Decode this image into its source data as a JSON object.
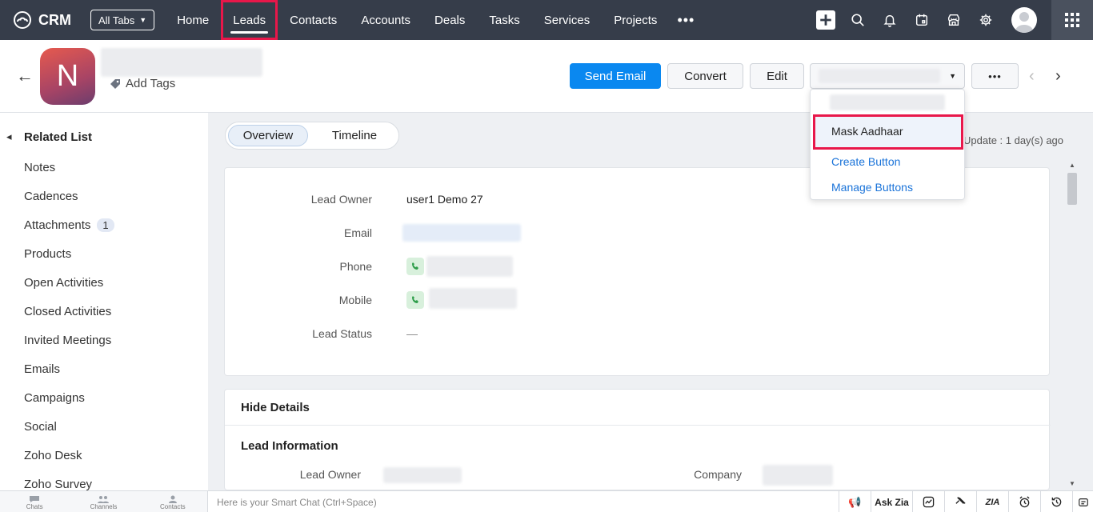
{
  "nav": {
    "brand": "CRM",
    "all_tabs": "All Tabs",
    "items": [
      "Home",
      "Leads",
      "Contacts",
      "Accounts",
      "Deals",
      "Tasks",
      "Services",
      "Projects"
    ],
    "active": "Leads",
    "more": "•••"
  },
  "record": {
    "avatar_letter": "N",
    "add_tags": "Add Tags",
    "buttons": {
      "send_email": "Send Email",
      "convert": "Convert",
      "edit": "Edit",
      "more": "•••"
    }
  },
  "dropdown": {
    "items": [
      "Mask Aadhaar",
      "Create Button",
      "Manage Buttons"
    ],
    "highlighted": "Mask Aadhaar"
  },
  "sidebar": {
    "title": "Related List",
    "items": [
      "Notes",
      "Cadences",
      "Attachments",
      "Products",
      "Open Activities",
      "Closed Activities",
      "Invited Meetings",
      "Emails",
      "Campaigns",
      "Social",
      "Zoho Desk",
      "Zoho Survey"
    ],
    "attachments_count": "1"
  },
  "tabs": {
    "overview": "Overview",
    "timeline": "Timeline"
  },
  "last_update": "Update : 1 day(s) ago",
  "fields": {
    "lead_owner_label": "Lead Owner",
    "lead_owner_value": "user1 Demo 27",
    "email_label": "Email",
    "phone_label": "Phone",
    "mobile_label": "Mobile",
    "lead_status_label": "Lead Status",
    "lead_status_value": "—"
  },
  "details": {
    "hide_details": "Hide Details",
    "section_title": "Lead Information",
    "lead_owner_label": "Lead Owner",
    "company_label": "Company"
  },
  "bottom": {
    "tabs": [
      "Chats",
      "Channels",
      "Contacts"
    ],
    "smart_chat": "Here is your Smart Chat (Ctrl+Space)",
    "ask_zia": "Ask Zia"
  },
  "colors": {
    "nav_bg": "#363d4a",
    "primary": "#0a88f0",
    "highlight": "#e8174a",
    "link": "#1a73d9"
  }
}
